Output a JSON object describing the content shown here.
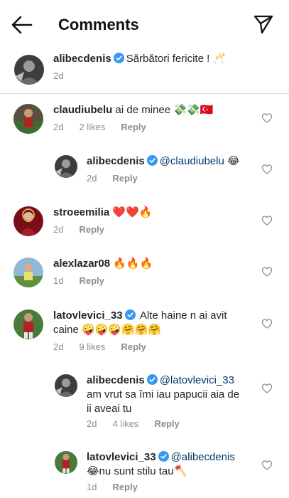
{
  "header": {
    "title": "Comments"
  },
  "caption": {
    "username": "alibecdenis",
    "text": "Sărbători fericite ! 🥂",
    "time": "2d"
  },
  "comments": [
    {
      "username": "claudiubelu",
      "text": "ai de minee 💸💸🇹🇷",
      "time": "2d",
      "likes": "2 likes",
      "reply": "Reply"
    },
    {
      "username": "alibecdenis",
      "mention": "@claudiubelu",
      "text": " 😂",
      "time": "2d",
      "reply": "Reply"
    },
    {
      "username": "stroeemilia",
      "text": "❤️❤️🔥",
      "time": "2d",
      "reply": "Reply"
    },
    {
      "username": "alexlazar08",
      "text": "🔥🔥🔥",
      "time": "1d",
      "reply": "Reply"
    },
    {
      "username": "latovlevici_33",
      "text": " Alte haine n ai avit",
      "text2": "caine 🤪🤪🤪🤗🤗🤗",
      "time": "2d",
      "likes": "9 likes",
      "reply": "Reply"
    },
    {
      "username": "alibecdenis",
      "mention": "@latovlevici_33",
      "text": "am vrut sa îmi iau papucii aia de",
      "text2": "ii aveai tu",
      "time": "2d",
      "likes": "4 likes",
      "reply": "Reply"
    },
    {
      "username": "latovlevici_33",
      "mention": "@alibecdenis",
      "text": "😂nu sunt stilu tau🪓",
      "time": "1d",
      "reply": "Reply"
    }
  ],
  "colors": {
    "verified": "#3897f0",
    "mention": "#00376b",
    "meta": "#8e8e8e"
  },
  "icons": [
    "back-arrow-icon",
    "send-icon",
    "verified-icon",
    "heart-icon"
  ]
}
